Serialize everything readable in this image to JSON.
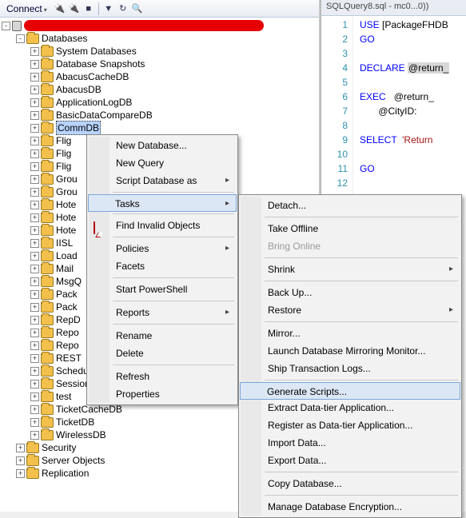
{
  "toolbar": {
    "connect_label": "Connect"
  },
  "tree": {
    "root_redacted": true,
    "databases_label": "Databases",
    "sysdatabases_label": "System Databases",
    "snapshots_label": "Database Snapshots",
    "dbs": [
      "AbacusCacheDB",
      "AbacusDB",
      "ApplicationLogDB",
      "BasicDataCompareDB",
      "CommDB",
      "Flig",
      "Flig",
      "Flig",
      "Grou",
      "Grou",
      "Hote",
      "Hote",
      "Hote",
      "IISL",
      "Load",
      "Mail",
      "MsgQ",
      "Pack",
      "Pack",
      "RepD",
      "Repo",
      "Repo",
      "REST",
      "SchedulerDB",
      "Session",
      "test",
      "TicketCacheDB",
      "TicketDB",
      "WirelessDB"
    ],
    "security_label": "Security",
    "serverobjects_label": "Server Objects",
    "replication_label": "Replication"
  },
  "menu1": {
    "items": [
      {
        "label": "New Database...",
        "sep": false
      },
      {
        "label": "New Query",
        "sep": false
      },
      {
        "label": "Script Database as",
        "sep": false,
        "sub": true
      },
      {
        "sep": true
      },
      {
        "label": "Tasks",
        "sep": false,
        "sub": true,
        "highlight": true
      },
      {
        "sep": true
      },
      {
        "label": "Find Invalid Objects",
        "icon": "redbubble",
        "sep": false
      },
      {
        "sep": true
      },
      {
        "label": "Policies",
        "sep": false,
        "sub": true
      },
      {
        "label": "Facets",
        "sep": false
      },
      {
        "sep": true
      },
      {
        "label": "Start PowerShell",
        "sep": false
      },
      {
        "sep": true
      },
      {
        "label": "Reports",
        "sep": false,
        "sub": true
      },
      {
        "sep": true
      },
      {
        "label": "Rename",
        "sep": false
      },
      {
        "label": "Delete",
        "sep": false
      },
      {
        "sep": true
      },
      {
        "label": "Refresh",
        "sep": false
      },
      {
        "label": "Properties",
        "sep": false
      }
    ]
  },
  "menu2": {
    "items": [
      {
        "label": "Detach..."
      },
      {
        "sep": true
      },
      {
        "label": "Take Offline"
      },
      {
        "label": "Bring Online",
        "disabled": true
      },
      {
        "sep": true
      },
      {
        "label": "Shrink",
        "sub": true
      },
      {
        "sep": true
      },
      {
        "label": "Back Up..."
      },
      {
        "label": "Restore",
        "sub": true
      },
      {
        "sep": true
      },
      {
        "label": "Mirror..."
      },
      {
        "label": "Launch Database Mirroring Monitor..."
      },
      {
        "label": "Ship Transaction Logs..."
      },
      {
        "sep": true
      },
      {
        "label": "Generate Scripts...",
        "highlight": true
      },
      {
        "label": "Extract Data-tier Application..."
      },
      {
        "label": "Register as Data-tier Application..."
      },
      {
        "label": "Import Data..."
      },
      {
        "label": "Export Data..."
      },
      {
        "sep": true
      },
      {
        "label": "Copy Database..."
      },
      {
        "sep": true
      },
      {
        "label": "Manage Database Encryption..."
      }
    ]
  },
  "editor": {
    "tab": "SQLQuery8.sql - mc0...0))",
    "lines": {
      "l1a": "USE",
      "l1b": " [PackageFHDB",
      "l2": "GO",
      "l3": "",
      "l4a": "DECLARE",
      "l4b": "@return_",
      "l5": "",
      "l6a": "EXEC",
      "l6b": "   @return_",
      "l7": "       @CityID:",
      "l8": "",
      "l9a": "SELECT",
      "l9b": "'Return",
      "l10": "",
      "l11": "GO",
      "l12": ""
    }
  }
}
